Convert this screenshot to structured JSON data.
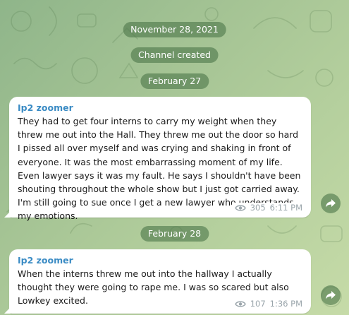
{
  "dates": {
    "first": "November 28, 2021",
    "second": "February 27",
    "third": "February 28"
  },
  "service": {
    "channel_created": "Channel created"
  },
  "messages": [
    {
      "sender": "Ip2 zoomer",
      "text": "They had to get four interns to carry my weight when they threw me out into the Hall. They threw me out the door so hard I pissed all over myself and was crying and shaking in front of everyone. It was the most embarrassing moment of my life. Even lawyer says it was my fault. He says I shouldn't have been shouting throughout the whole show but I just got carried away. I'm still going to sue once I get a new lawyer who understands my emotions.",
      "views": "305",
      "time": "6:11 PM",
      "views_icon": "eye-icon",
      "share_icon": "share-arrow-icon"
    },
    {
      "sender": "Ip2 zoomer",
      "text": "When the interns threw me out into the hallway I actually thought they were going to rape me. I was so scared but also Lowkey excited.",
      "views": "107",
      "time": "1:36 PM",
      "views_icon": "eye-icon",
      "share_icon": "share-arrow-icon"
    }
  ],
  "colors": {
    "sender": "#3a8bc4",
    "pill_bg": "#4e784a",
    "meta": "#9aa5ab"
  }
}
